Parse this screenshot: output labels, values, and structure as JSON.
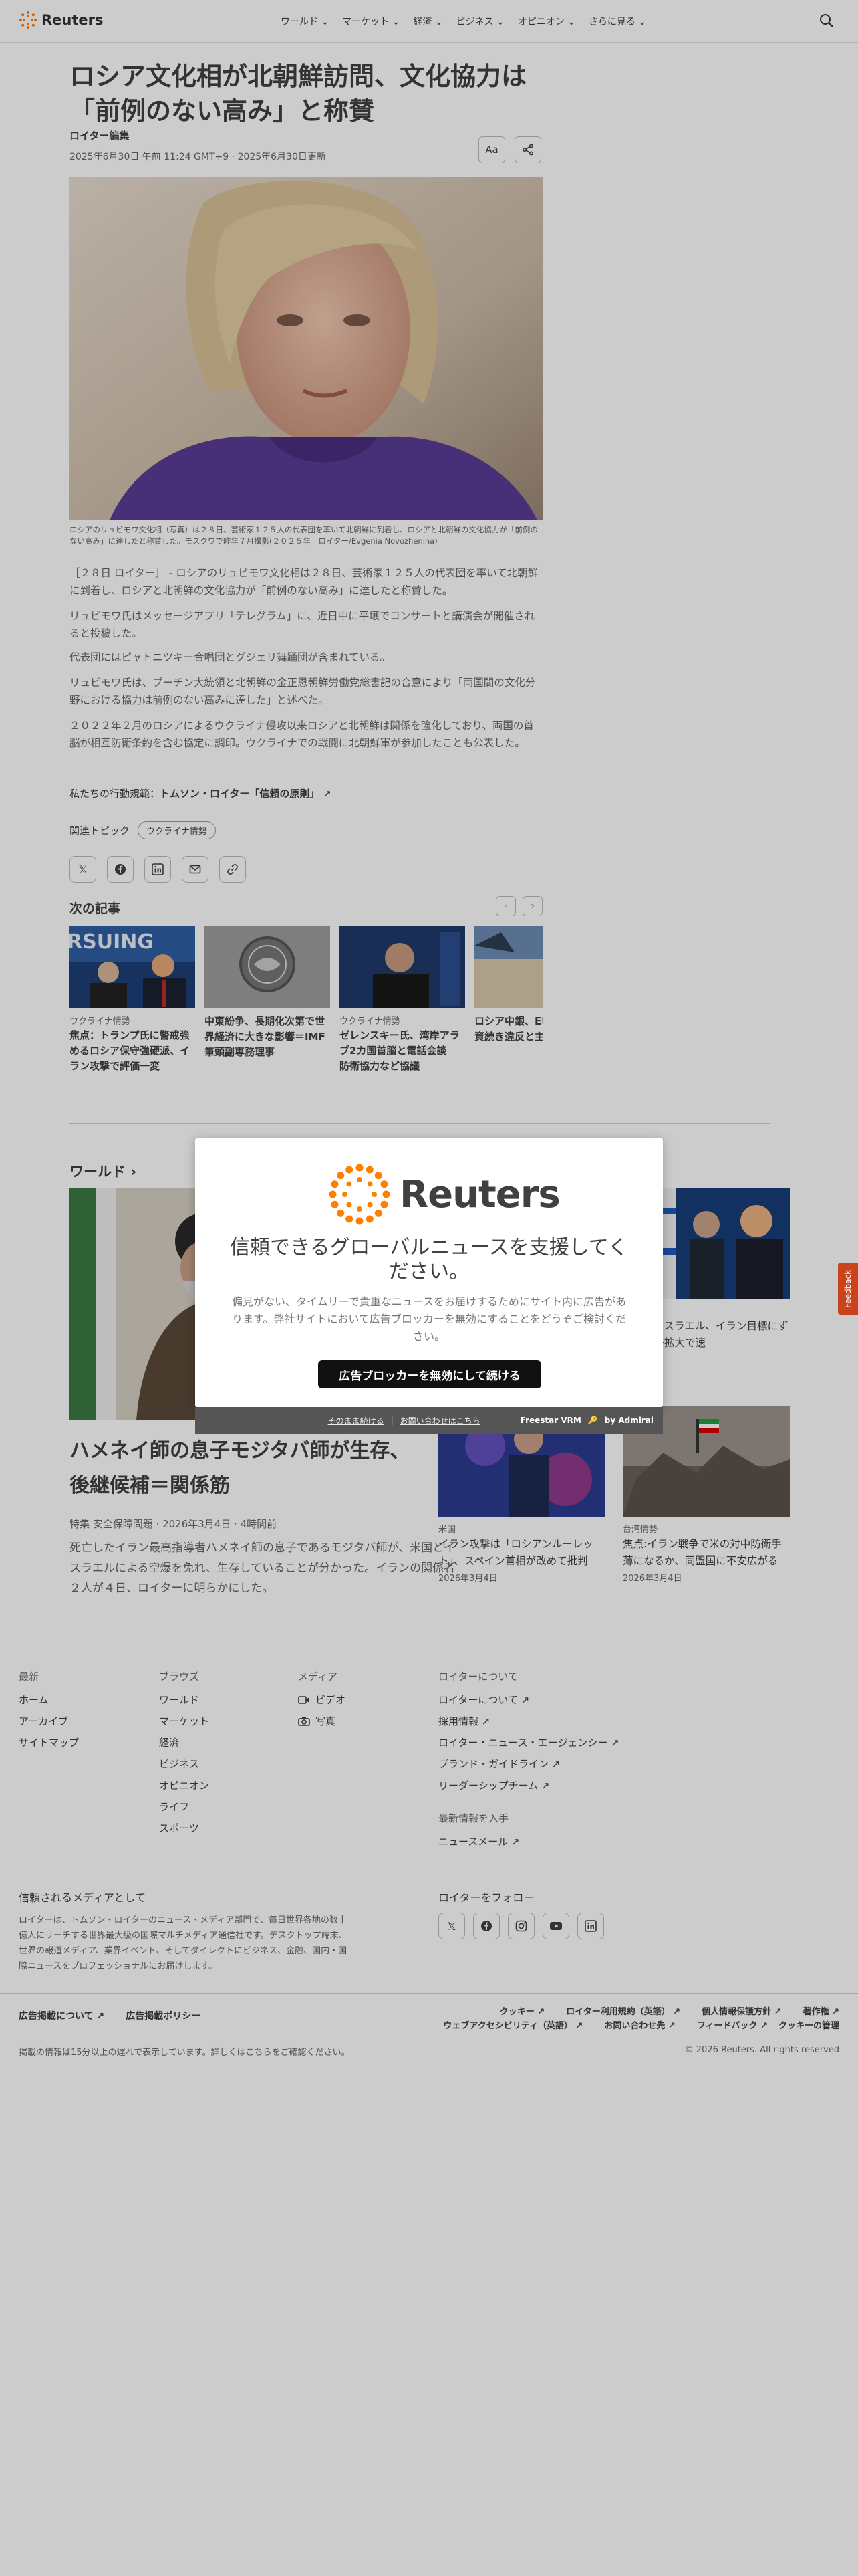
{
  "header": {
    "logo_text": "Reuters",
    "nav": [
      "ワールド",
      "マーケット",
      "経済",
      "ビジネス",
      "オピニオン",
      "さらに見る"
    ]
  },
  "article": {
    "title": "ロシア文化相が北朝鮮訪問、文化協力は「前例のない高み」と称賛",
    "byline": "ロイター編集",
    "dateline": "2025年6月30日 午前 11:24 GMT+9 · 2025年6月30日更新",
    "text_size_label": "Aa",
    "caption": "ロシアのリュビモワ文化相（写真）は２８日、芸術家１２５人の代表団を率いて北朝鮮に到着し、ロシアと北朝鮮の文化協力が「前例のない高み」に達したと称賛した。モスクワで昨年７月撮影(２０２５年　ロイター/Evgenia Novozhenina)",
    "paragraphs": [
      "［２８日 ロイター］ - ロシアのリュビモワ文化相は２８日、芸術家１２５人の代表団を率いて北朝鮮に到着し、ロシアと北朝鮮の文化協力が「前例のない高み」に達したと称賛した。",
      "リュビモワ氏はメッセージアプリ「テレグラム」に、近日中に平壌でコンサートと講演会が開催されると投稿した。",
      "代表団にはピャトニツキー合唱団とグジェリ舞踊団が含まれている。",
      "リュビモワ氏は、プーチン大統領と北朝鮮の金正恩朝鮮労働党総書記の合意により「両国間の文化分野における協力は前例のない高みに達した」と述べた。",
      "２０２２年２月のロシアによるウクライナ侵攻以来ロシアと北朝鮮は関係を強化しており、両国の首脳が相互防衛条約を含む協定に調印。ウクライナでの戦闘に北朝鮮軍が参加したことも公表した。"
    ],
    "standards_prefix": "私たちの行動規範：",
    "standards_link": "トムソン・ロイター「信頼の原則」",
    "topics_label": "関連トピック",
    "topic": "ウクライナ情勢"
  },
  "next": {
    "title": "次の記事",
    "cards": [
      {
        "kicker": "ウクライナ情勢",
        "title": "焦点：トランプ氏に警戒強めるロシア保守強硬派、イラン攻撃で評価一変"
      },
      {
        "kicker": "",
        "title": "中東紛争、長期化次第で世界経済に大きな影響＝IMF筆頭副専務理事"
      },
      {
        "kicker": "ウクライナ情勢",
        "title": "ゼレンスキー氏、湾岸アラブ2カ国首脳と電話会談　防衛協力など協議"
      },
      {
        "kicker": "",
        "title": "ロシア中銀、E申し立て　資続き違反と主"
      }
    ]
  },
  "world": {
    "title": "ワールド",
    "main": {
      "headline": "ハメネイ師の息子モジタバ師が生存、後継候補＝関係筋",
      "meta": "特集 安全保障問題 · 2026年3月4日 · 4時間前",
      "desc": "死亡したイラン最高指導者ハメネイ師の息子であるモジタバ師が、米国とイスラエルによる空爆を免れ、生存していることが分かった。イランの関係者２人が４日、ロイターに明らかにした。"
    },
    "side": [
      {
        "kicker": "情特集",
        "title": "：米とイスラエル、イラン目標にずれ　紛争拡大で速",
        "date": "3月4日"
      },
      {
        "kicker": "米国",
        "title": "イラン攻撃は「ロシアンルーレット」、スペイン首相が改めて批判",
        "date": "2026年3月4日"
      },
      {
        "kicker": "台湾情勢",
        "title": "焦点:イラン戦争で米の対中防衛手薄になるか、同盟国に不安広がる",
        "date": "2026年3月4日"
      }
    ]
  },
  "footer": {
    "col1": {
      "heading": "最新",
      "items": [
        "ホーム",
        "アーカイブ",
        "サイトマップ"
      ]
    },
    "col2": {
      "heading": "ブラウズ",
      "items": [
        "ワールド",
        "マーケット",
        "経済",
        "ビジネス",
        "オピニオン",
        "ライフ",
        "スポーツ"
      ]
    },
    "col3": {
      "heading": "メディア",
      "items": [
        "ビデオ",
        "写真"
      ]
    },
    "col4": {
      "heading": "ロイターについて",
      "items": [
        "ロイターについて",
        "採用情報",
        "ロイター・ニュース・エージェンシー",
        "ブランド・ガイドライン",
        "リーダーシップチーム"
      ]
    },
    "col5": {
      "heading": "最新情報を入手",
      "items": [
        "ニュースメール"
      ]
    },
    "trusted_title": "信頼されるメディアとして",
    "trusted_text": "ロイターは、トムソン・ロイターのニュース・メディア部門で、毎日世界各地の数十億人にリーチする世界最大級の国際マルチメディア通信社です。デスクトップ端末、世界の報道メディア、業界イベント、そしてダイレクトにビジネス、金融、国内・国際ニュースをプロフェッショナルにお届けします。",
    "follow_title": "ロイターをフォロー",
    "legal_left": [
      "広告掲載について",
      "広告掲載ポリシー"
    ],
    "legal_right": [
      "クッキー",
      "ロイター利用規約（英語）",
      "個人情報保護方針",
      "著作権",
      "ウェブアクセシビリティ（英語）",
      "お問い合わせ先",
      "フィードバック",
      "クッキーの管理"
    ],
    "delay": "掲載の情報は15分以上の遅れで表示しています。詳しくはこちらをご確認ください。",
    "copyright": "© 2026 Reuters. All rights reserved"
  },
  "modal": {
    "logo_text": "Reuters",
    "title": "信頼できるグローバルニュースを支援してください。",
    "text": "偏見がない、タイムリーで貴重なニュースをお届けするためにサイト内に広告があります。弊社サイトにおいて広告ブロッカーを無効にすることをどうぞご検討ください。",
    "button": "広告ブロッカーを無効にして続ける",
    "continue_link": "そのまま続ける",
    "contact_link": "お問い合わせはこちら",
    "powered": "Freestar VRM",
    "by": "by Admiral"
  },
  "feedback": "Feedback",
  "colors": {
    "accent": "#ff8000",
    "feedback": "#c9441c",
    "modal_button": "#111111"
  }
}
